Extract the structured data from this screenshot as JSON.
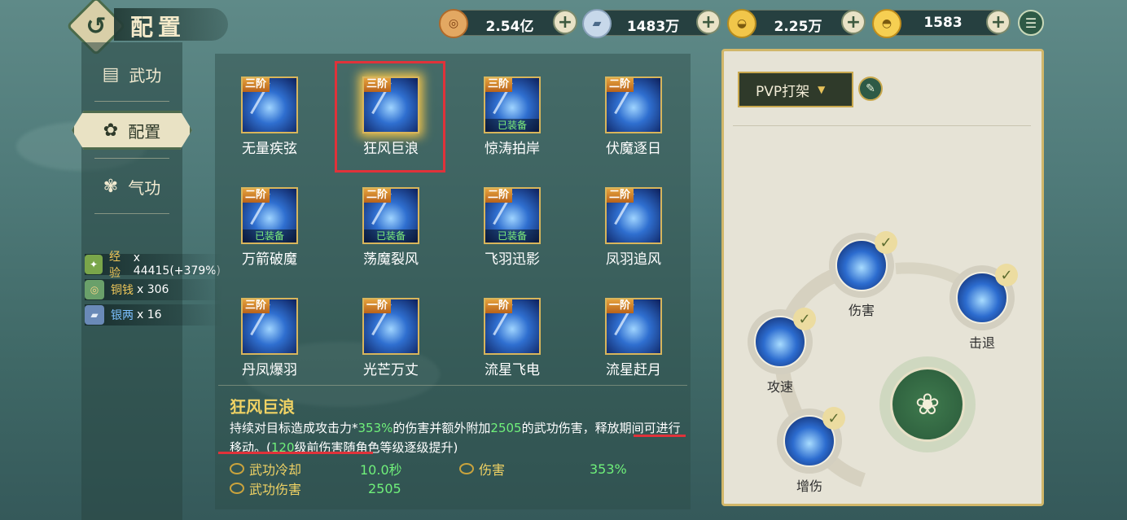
{
  "header": {
    "title": "配置"
  },
  "currencies": [
    {
      "icon": "copper-coin-icon",
      "value": "2.54亿"
    },
    {
      "icon": "silver-ingot-icon",
      "value": "1483万"
    },
    {
      "icon": "gold-ingot-icon",
      "value": "2.25万"
    },
    {
      "icon": "gold-yuanbao-icon",
      "value": "1583"
    }
  ],
  "sidebar": {
    "items": [
      {
        "label": "武功",
        "icon": "cards-icon"
      },
      {
        "label": "配置",
        "icon": "swirl-icon",
        "selected": true
      },
      {
        "label": "气功",
        "icon": "spiral-icon"
      }
    ]
  },
  "rewards": [
    {
      "name": "经验",
      "value": "x 44415(+379%)"
    },
    {
      "name": "铜钱",
      "value": "x 306"
    },
    {
      "name": "银两",
      "value": "x 16"
    }
  ],
  "skills": [
    {
      "name": "无量疾弦",
      "rank": "三阶",
      "equipped": ""
    },
    {
      "name": "狂风巨浪",
      "rank": "三阶",
      "equipped": "",
      "selected": true
    },
    {
      "name": "惊涛拍岸",
      "rank": "三阶",
      "equipped": "已装备"
    },
    {
      "name": "伏魔逐日",
      "rank": "二阶",
      "equipped": ""
    },
    {
      "name": "万箭破魔",
      "rank": "二阶",
      "equipped": "已装备"
    },
    {
      "name": "荡魔裂风",
      "rank": "二阶",
      "equipped": "已装备"
    },
    {
      "name": "飞羽迅影",
      "rank": "二阶",
      "equipped": "已装备"
    },
    {
      "name": "凤羽追风",
      "rank": "二阶",
      "equipped": ""
    },
    {
      "name": "丹凤爆羽",
      "rank": "三阶",
      "equipped": ""
    },
    {
      "name": "光芒万丈",
      "rank": "一阶",
      "equipped": ""
    },
    {
      "name": "流星飞电",
      "rank": "一阶",
      "equipped": ""
    },
    {
      "name": "流星赶月",
      "rank": "一阶",
      "equipped": ""
    }
  ],
  "detail": {
    "title": "狂风巨浪",
    "desc_1": "持续对目标造成攻击力*",
    "desc_pct": "353%",
    "desc_2": "的伤害并额外附加",
    "desc_add": "2505",
    "desc_3": "的武功伤害，释放期间可进行移动。(",
    "desc_lv": "120",
    "desc_4": "级前伤害随角色等级逐级提升)",
    "stats": [
      {
        "label": "武功冷却",
        "value": "10.0秒"
      },
      {
        "label": "伤害",
        "value": "353%"
      },
      {
        "label": "武功伤害",
        "value": "2505"
      }
    ]
  },
  "loadout": {
    "preset": "PVP打架",
    "nodes": [
      "伤害",
      "击退",
      "攻速",
      "增伤"
    ]
  }
}
